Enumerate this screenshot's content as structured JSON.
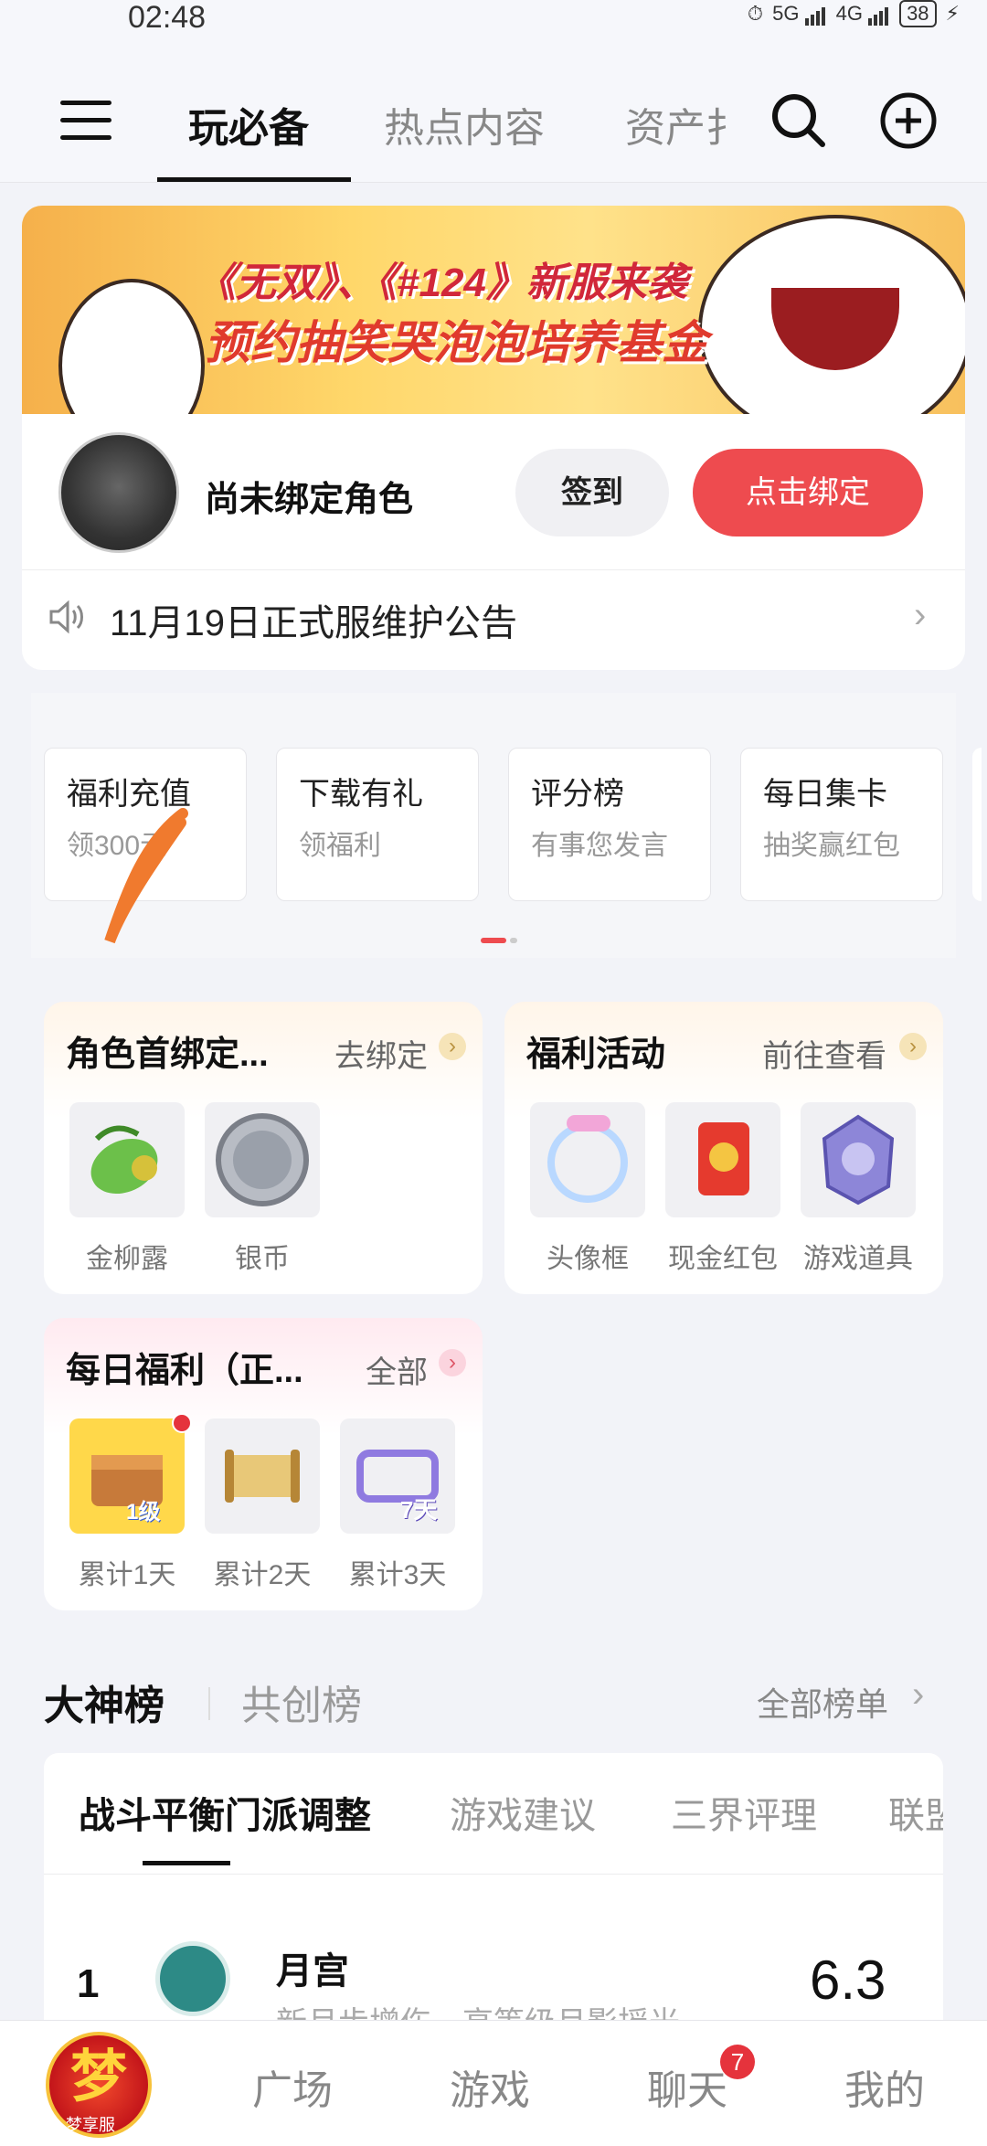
{
  "status": {
    "time": "02:48",
    "battery": "38",
    "network1": "5G",
    "network2": "4G"
  },
  "header": {
    "tabs": [
      "玩必备",
      "热点内容",
      "资产扌"
    ]
  },
  "banner": {
    "line1": "《无双》、《#124》新服来袭",
    "line2": "预约抽笑哭泡泡培养基金"
  },
  "bind": {
    "name": "尚未绑定角色",
    "signin_label": "签到",
    "bind_label": "点击绑定"
  },
  "notice": {
    "text": "11月19日正式服维护公告"
  },
  "shortcuts": [
    {
      "title": "福利充值",
      "sub": "领300元"
    },
    {
      "title": "下载有礼",
      "sub": "领福利"
    },
    {
      "title": "评分榜",
      "sub": "有事您发言"
    },
    {
      "title": "每日集卡",
      "sub": "抽奖赢红包"
    }
  ],
  "cards": {
    "bind_first": {
      "title": "角色首绑定...",
      "more": "去绑定",
      "items": [
        "金柳露",
        "银币"
      ]
    },
    "welfare": {
      "title": "福利活动",
      "more": "前往查看",
      "items": [
        "头像框",
        "现金红包",
        "游戏道具"
      ]
    },
    "daily": {
      "title": "每日福利（正...",
      "more": "全部",
      "items": [
        "累计1天",
        "累计2天",
        "累计3天"
      ],
      "badges": [
        "1级",
        "7天"
      ]
    }
  },
  "rank": {
    "tab_main": "大神榜",
    "tab_alt": "共创榜",
    "all": "全部榜单",
    "subtabs": [
      "战斗平衡门派调整",
      "游戏建议",
      "三界评理",
      "联盟"
    ],
    "first": {
      "rank": "1",
      "name": "月宫",
      "desc": "新月步增伤，高等级月影摇光",
      "score": "6.3"
    }
  },
  "bottomnav": {
    "items": [
      "广场",
      "游戏",
      "聊天",
      "我的"
    ],
    "chat_badge": "7",
    "logo_text": "梦",
    "logo_sub": "梦享服"
  },
  "colors": {
    "accent": "#ee4b4f",
    "badge": "#e5333c"
  }
}
